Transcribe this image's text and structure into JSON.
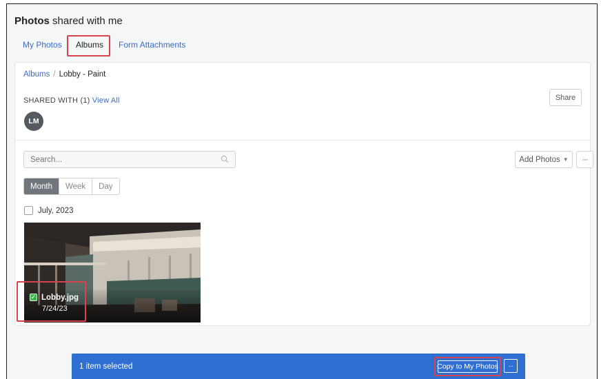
{
  "header": {
    "title_bold": "Photos",
    "title_rest": " shared with me",
    "tabs": [
      {
        "label": "My Photos",
        "active": false
      },
      {
        "label": "Albums",
        "active": true
      },
      {
        "label": "Form Attachments",
        "active": false
      }
    ]
  },
  "album": {
    "breadcrumb_root": "Albums",
    "breadcrumb_sep": "/",
    "breadcrumb_current": "Lobby - Paint",
    "shared_label": "SHARED WITH (1)",
    "view_all": "View All",
    "share_button": "Share",
    "avatar_initials": "LM"
  },
  "toolbar": {
    "search_placeholder": "Search...",
    "add_photos": "Add Photos",
    "more": "···",
    "views": [
      {
        "label": "Month",
        "active": true
      },
      {
        "label": "Week",
        "active": false
      },
      {
        "label": "Day",
        "active": false
      }
    ]
  },
  "group": {
    "month_label": "July, 2023"
  },
  "photo": {
    "name": "Lobby.jpg",
    "date": "7/24/23",
    "selected": true
  },
  "selection_bar": {
    "text": "1 item selected",
    "copy_button": "Copy to My Photos",
    "more": "···"
  },
  "colors": {
    "link": "#3a6bc9",
    "selection_bar": "#2f6fd1",
    "highlight": "#d9434f",
    "check": "#3cb94a"
  }
}
